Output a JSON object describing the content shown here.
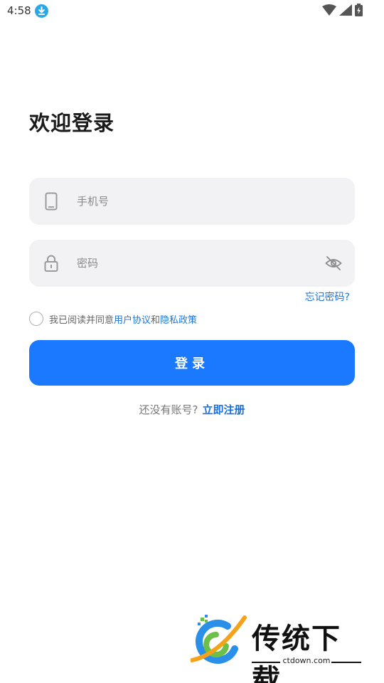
{
  "status_bar": {
    "time": "4:58",
    "icons": [
      "download-icon",
      "wifi-icon",
      "signal-icon",
      "battery-icon"
    ]
  },
  "login": {
    "title": "欢迎登录",
    "phone_placeholder": "手机号",
    "password_placeholder": "密码",
    "forgot_password": "忘记密码?",
    "agreement_prefix": "我已阅读并同意",
    "user_agreement": "用户协议",
    "agreement_and": "和",
    "privacy_policy": "隐私政策",
    "login_button": "登录",
    "no_account_text": "还没有账号?",
    "register_link": "立即注册"
  },
  "watermark": {
    "brand": "传统下载",
    "url": "ctdown.com"
  },
  "colors": {
    "accent": "#1a79ff",
    "link": "#1d76d8",
    "field_bg": "#f2f2f4"
  }
}
